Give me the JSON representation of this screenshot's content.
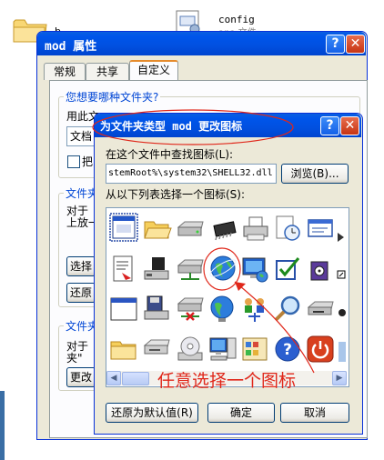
{
  "desktop": {
    "file_config_name": "config",
    "file_config_sub": "ana 文件",
    "folder_partial_label": "b"
  },
  "props_window": {
    "title": "mod 属性",
    "help_label": "?",
    "close_label": "✕",
    "tabs": [
      {
        "label": "常规",
        "active": false
      },
      {
        "label": "共享",
        "active": false
      },
      {
        "label": "自定义",
        "active": true
      }
    ],
    "group1_title": "您想要哪种文件夹?",
    "group1_text": "用此文",
    "group1_select_value": "文档",
    "group1_checkbox_label": "把",
    "group2_title": "文件夹",
    "group2_text1": "对于",
    "group2_text2": "上放一",
    "choose_button": "选择",
    "restore_button": "还原",
    "group3_title": "文件夹",
    "group3_text1": "对于",
    "group3_text2": "夹\"",
    "change_button": "更改"
  },
  "icon_dialog": {
    "title": "为文件夹类型 mod 更改图标",
    "help_label": "?",
    "close_label": "✕",
    "find_label": "在这个文件中查找图标(L):",
    "path_value": "stemRoot%\\system32\\SHELL32.dll",
    "browse_button": "浏览(B)...",
    "list_label": "从以下列表选择一个图标(S):",
    "restore_default_button": "还原为默认值(R)",
    "ok_button": "确定",
    "cancel_button": "取消"
  },
  "annotation": {
    "text": "任意选择一个图标",
    "color": "#e0271a"
  },
  "icons": [
    "window-app-icon",
    "folder-open-icon",
    "drive-icon",
    "chip-icon",
    "printer-icon",
    "clock-doc-icon",
    "display-props-icon",
    "arrow-icon",
    "document-icon",
    "pc-drive-icon",
    "network-drive-icon",
    "globe-icon",
    "monitor-globe-icon",
    "checkbox-icon",
    "burn-cd-icon",
    "shortcut-icon",
    "blank-window-icon",
    "save-drive-icon",
    "disconnected-drive-icon",
    "network-globe-icon",
    "network-users-icon",
    "search-icon",
    "cd-drive-icon",
    "misc-icon",
    "folder-icon",
    "floppy-drive-icon",
    "cd-icon",
    "computer-icon",
    "control-panel-icon",
    "help-icon",
    "shutdown-icon",
    "partial-icon"
  ]
}
